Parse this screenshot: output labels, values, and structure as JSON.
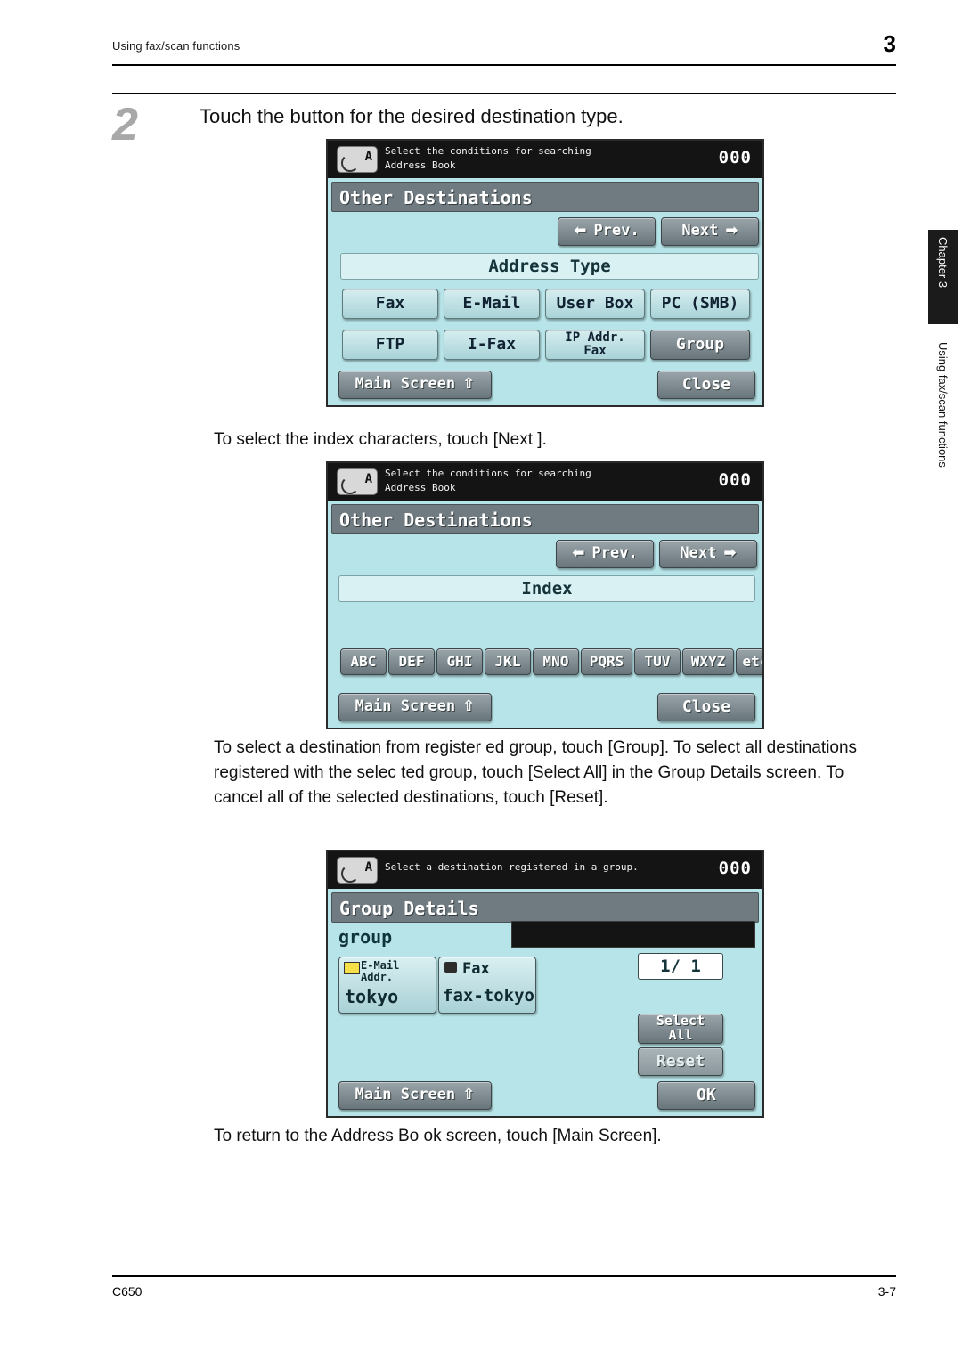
{
  "header": {
    "running_head": "Using fax/scan functions",
    "chapter_number": "3"
  },
  "step": {
    "number": "2",
    "title": "Touch the button  for the desired destination type."
  },
  "paragraphs": {
    "p1": "To select the index characters, touch [Next    ].",
    "p2": "To select a destination from register ed group, touch [Group]. To select all destinations registered with the selec ted group, touch [Select All] in the Group Details screen. To cancel all of the selected destinations, touch [Reset].",
    "p3": "To return to the Address Bo ok screen, touch [Main Screen]."
  },
  "side_tab": {
    "chapter_label": "Chapter 3",
    "section_label": "Using fax/scan functions"
  },
  "footer": {
    "model": "C650",
    "page": "3-7"
  },
  "screen1": {
    "status_line1": "Select the conditions for searching",
    "status_line2": "Address Book",
    "counter": "000",
    "title": "Other Destinations",
    "prev_label": "Prev.",
    "next_label": "Next",
    "prev_icon": "arrow-left-icon",
    "next_icon": "arrow-right-icon",
    "section_label": "Address Type",
    "buttons_row1": [
      "Fax",
      "E-Mail",
      "User Box",
      "PC (SMB)"
    ],
    "buttons_row2": [
      "FTP",
      "I-Fax",
      "IP Addr.\nFax",
      "Group"
    ],
    "main_screen_label": "Main Screen",
    "main_screen_icon": "up-arrow-icon",
    "close_label": "Close"
  },
  "screen2": {
    "status_line1": "Select the conditions for searching",
    "status_line2": "Address Book",
    "counter": "000",
    "title": "Other Destinations",
    "prev_label": "Prev.",
    "next_label": "Next",
    "section_label": "Index",
    "index_buttons": [
      "ABC",
      "DEF",
      "GHI",
      "JKL",
      "MNO",
      "PQRS",
      "TUV",
      "WXYZ",
      "etc"
    ],
    "main_screen_label": "Main Screen",
    "close_label": "Close"
  },
  "screen3": {
    "status_line1": "Select a destination registered in a group.",
    "counter": "000",
    "title": "Group Details",
    "group_name": "group",
    "dest1_type": "E-Mail\nAddr.",
    "dest1_name": "tokyo",
    "dest1_icon": "envelope-icon",
    "dest2_type": "Fax",
    "dest2_name": "fax-tokyo",
    "dest2_icon": "fax-icon",
    "page_indicator": "1/ 1",
    "select_all_label": "Select\nAll",
    "reset_label": "Reset",
    "main_screen_label": "Main Screen",
    "ok_label": "OK"
  }
}
